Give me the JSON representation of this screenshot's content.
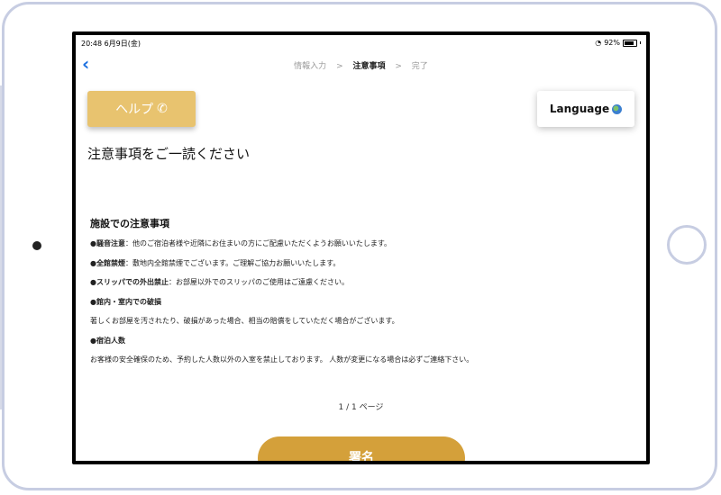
{
  "status": {
    "time_date": "20:48  6月9日(金)",
    "battery": "92%"
  },
  "nav": {
    "back_icon": "chevron-left-icon"
  },
  "steps": [
    {
      "label": "情報入力",
      "state": "done"
    },
    {
      "separator": ">"
    },
    {
      "label": "注意事項",
      "state": "active"
    },
    {
      "separator": ">"
    },
    {
      "label": "完了",
      "state": "pending"
    }
  ],
  "help": {
    "label": "ヘルプ",
    "icon": "phone-icon",
    "color": "#e8c36f"
  },
  "language": {
    "label": "Language",
    "icon": "globe-icon"
  },
  "page_title": "注意事項をご一読ください",
  "section_title": "施設での注意事項",
  "notices": [
    {
      "label": "●騒音注意",
      "text": "：他のご宿泊者様や近隣にお住まいの方にご配慮いただくようお願いいたします。"
    },
    {
      "label": "●全館禁煙",
      "text": "：敷地内全館禁煙でございます。ご理解ご協力お願いいたします。"
    },
    {
      "label": "●スリッパでの外出禁止",
      "text": "：お部屋以外でのスリッパのご使用はご遠慮ください。"
    },
    {
      "label": "●館内・室内での破損",
      "text": ""
    },
    {
      "label": "",
      "text": "著しくお部屋を汚されたり、破損があった場合、相当の賠償をしていただく場合がございます。"
    },
    {
      "label": "●宿泊人数",
      "text": ""
    },
    {
      "label": "",
      "text": "お客様の安全確保のため、予約した人数以外の入室を禁止しております。 人数が変更になる場合は必ずご連絡下さい。"
    }
  ],
  "pager": "1 / 1 ページ",
  "sign": {
    "label": "署名",
    "color": "#d4a03a"
  }
}
